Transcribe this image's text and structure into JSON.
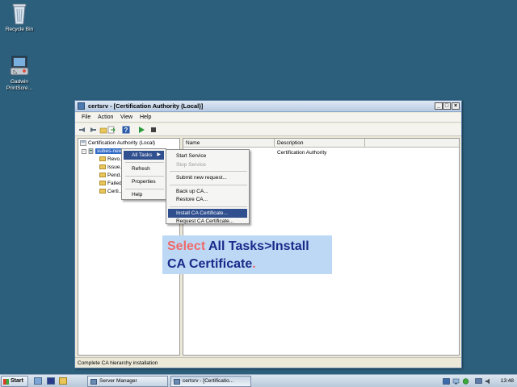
{
  "desktop": {
    "icons": [
      {
        "label": "Recycle Bin",
        "icon": "recycle-bin-icon"
      },
      {
        "label": "Gadwin PrintScre...",
        "icon": "printscreen-icon"
      }
    ]
  },
  "window": {
    "title": "certsrv - [Certification Authority (Local)]",
    "buttons": {
      "minimize": "_",
      "maximize": "□",
      "close": "×"
    },
    "menu": [
      "File",
      "Action",
      "View",
      "Help"
    ],
    "toolbar_icons": [
      "back-icon",
      "forward-icon",
      "up-icon",
      "export-icon",
      "help-icon",
      "play-icon",
      "stop-icon"
    ]
  },
  "tree": {
    "root": "Certification Authority (Local)",
    "selected_node": "subes-new...",
    "children": [
      "Revo...",
      "Issue...",
      "Pend...",
      "Failed...",
      "Certi..."
    ]
  },
  "list": {
    "columns": [
      "Name",
      "Description"
    ],
    "rows": [
      {
        "name": "",
        "description": "Certification Authority"
      }
    ]
  },
  "context_menu": {
    "items": [
      {
        "label": "All Tasks",
        "highlighted": true,
        "submenu": true
      },
      {
        "label": "Refresh"
      },
      {
        "label": "Properties"
      },
      {
        "label": "Help"
      }
    ]
  },
  "submenu": {
    "items": [
      {
        "label": "Start Service",
        "disabled": false
      },
      {
        "label": "Stop Service",
        "disabled": true
      },
      {
        "label": "Submit new request...",
        "disabled": false
      },
      {
        "label": "Back up CA...",
        "disabled": false
      },
      {
        "label": "Restore CA...",
        "disabled": false
      },
      {
        "label": "Install CA Certificate...",
        "highlighted": true
      },
      {
        "label": "Request CA Certificate...",
        "disabled": false
      }
    ]
  },
  "callout": {
    "word1": "Select",
    "rest_line1": " All Tasks>Install",
    "line2": "CA Certificate",
    "dot": "."
  },
  "status_bar": {
    "text": "Complete CA hierarchy installation"
  },
  "taskbar": {
    "start_label": "Start",
    "tasks": [
      {
        "label": "Server Manager",
        "active": false
      },
      {
        "label": "certsrv - [Certificatio...",
        "active": true
      }
    ],
    "clock": "13:48"
  },
  "colors": {
    "desktop": "#2c5f7c",
    "selection": "#316ac5",
    "menu_highlight": "#2f4f8f",
    "callout_bg": "#bcd8f5",
    "callout_text": "#1a2a8a",
    "callout_accent": "#ee6b6b"
  }
}
